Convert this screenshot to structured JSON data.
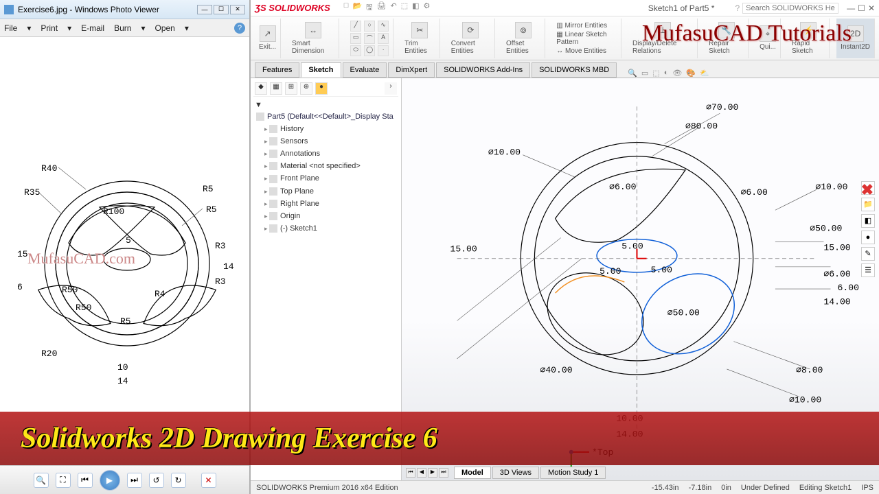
{
  "wpv": {
    "title": "Exercise6.jpg - Windows Photo Viewer",
    "menu": {
      "file": "File",
      "print": "Print",
      "email": "E-mail",
      "burn": "Burn",
      "open": "Open"
    },
    "watermark": "MufasuCAD.com",
    "ref_dims": {
      "r40": "R40",
      "r35": "R35",
      "r100": "R100",
      "r5a": "R5",
      "r5b": "R5",
      "h15": "15",
      "h6": "6",
      "r50a": "R50",
      "r50b": "R50",
      "r20": "R20",
      "r5c": "R5",
      "d10": "10",
      "d14": "14",
      "r3a": "R3",
      "r3b": "R3",
      "r4": "R4",
      "v14": "14",
      "d5": "5"
    }
  },
  "sw": {
    "logo": "SOLIDWORKS",
    "qat": [
      "□",
      "▾",
      "🖫",
      "▾",
      "🖨",
      "⬚",
      "◧",
      "▾",
      "▦",
      "⧉"
    ],
    "doc_title": "Sketch1 of Part5 *",
    "search_placeholder": "Search SOLIDWORKS Help",
    "ribbon": {
      "exit": "Exit...",
      "smart_dim": "Smart Dimension",
      "trim": "Trim Entities",
      "convert": "Convert Entities",
      "offset": "Offset Entities",
      "mirror": "Mirror Entities",
      "linear": "Linear Sketch Pattern",
      "move": "Move Entities",
      "display_rel": "Display/Delete Relations",
      "repair": "Repair Sketch",
      "quick": "Qui...",
      "rapid": "Rapid Sketch",
      "instant": "Instant2D"
    },
    "tabs": [
      "Features",
      "Sketch",
      "Evaluate",
      "DimXpert",
      "SOLIDWORKS Add-Ins",
      "SOLIDWORKS MBD"
    ],
    "active_tab": "Sketch",
    "tree": {
      "root": "Part5  (Default<<Default>_Display Sta",
      "items": [
        "History",
        "Sensors",
        "Annotations",
        "Material <not specified>",
        "Front Plane",
        "Top Plane",
        "Right Plane",
        "Origin",
        "(-) Sketch1"
      ]
    },
    "bottom_tabs": {
      "model": "Model",
      "views3d": "3D Views",
      "motion": "Motion Study 1",
      "top_label": "*Top"
    },
    "status": {
      "edition": "SOLIDWORKS Premium 2016 x64 Edition",
      "x": "-15.43in",
      "y": "-7.18in",
      "z": "0in",
      "state": "Under Defined",
      "mode": "Editing Sketch1",
      "units": "IPS"
    },
    "dims": {
      "d70": "∅70.00",
      "d80": "∅80.00",
      "d10a": "∅10.00",
      "d10b": "∅10.00",
      "d6a": "∅6.00",
      "d6b": "∅6.00",
      "d50a": "∅50.00",
      "d50b": "∅50.00",
      "d6c": "∅6.00",
      "v15a": "15.00",
      "v15b": "15.00",
      "v14a": "14.00",
      "v6": "6.00",
      "d40": "∅40.00",
      "v5a": "5.00",
      "v5b": "5.00",
      "v5c": "5.00",
      "d8": "∅8.00",
      "d10c": "∅10.00",
      "h10": "10.00",
      "h14": "14.00"
    }
  },
  "banner": "Solidworks 2D Drawing Exercise 6",
  "top_watermark": "MufasuCAD Tutorials"
}
